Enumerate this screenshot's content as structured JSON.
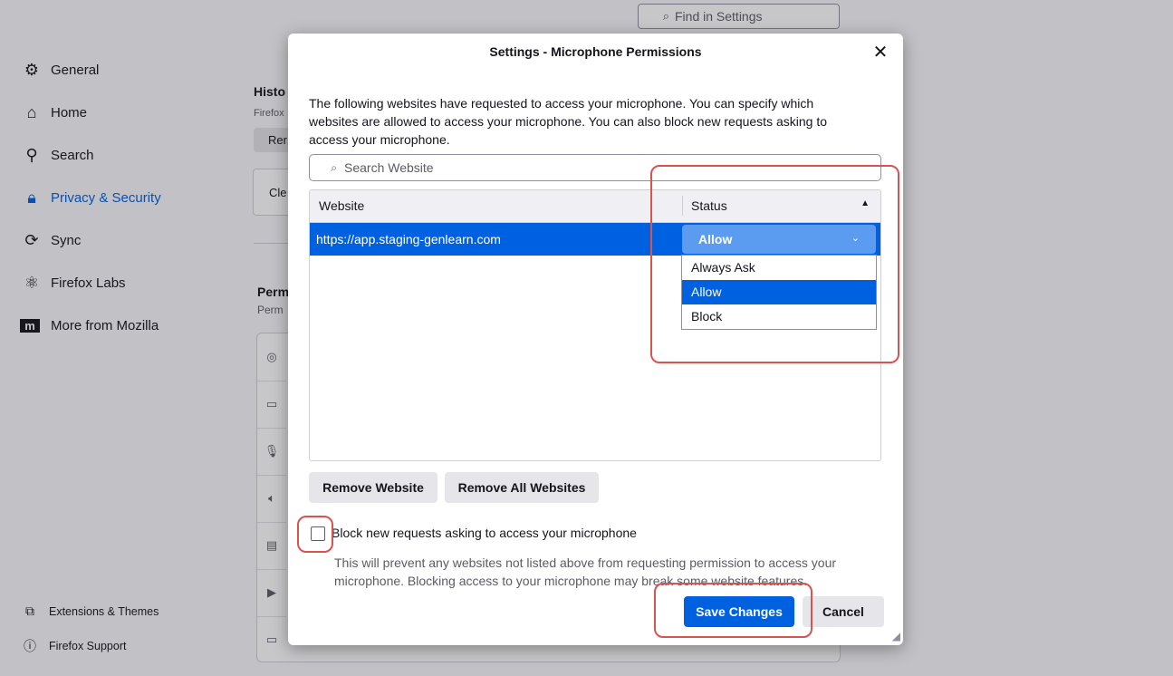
{
  "background": {
    "find_placeholder": "Find in Settings",
    "sidebar": [
      {
        "label": "General",
        "icon": "gear-icon"
      },
      {
        "label": "Home",
        "icon": "home-icon"
      },
      {
        "label": "Search",
        "icon": "search-icon"
      },
      {
        "label": "Privacy & Security",
        "icon": "lock-icon",
        "active": true
      },
      {
        "label": "Sync",
        "icon": "sync-icon"
      },
      {
        "label": "Firefox Labs",
        "icon": "labs-icon"
      },
      {
        "label": "More from Mozilla",
        "icon": "mozilla-icon"
      }
    ],
    "footer": [
      {
        "label": "Extensions & Themes",
        "icon": "puzzle-icon"
      },
      {
        "label": "Firefox Support",
        "icon": "help-icon"
      }
    ],
    "history_heading": "Histo",
    "history_sub": "Firefox",
    "history_btn": "Rer",
    "clear_btn": "Cle",
    "perm_heading": "Perm",
    "perm_sub": "Perm"
  },
  "dialog": {
    "title": "Settings - Microphone Permissions",
    "close_glyph": "✕",
    "description": "The following websites have requested to access your microphone. You can specify which websites are allowed to access your microphone. You can also block new requests asking to access your microphone.",
    "search_placeholder": "Search Website",
    "columns": {
      "website": "Website",
      "status": "Status"
    },
    "rows": [
      {
        "website": "https://app.staging-genlearn.com",
        "status": "Allow"
      }
    ],
    "status_options": [
      "Always Ask",
      "Allow",
      "Block"
    ],
    "selected_option": "Allow",
    "remove_website": "Remove Website",
    "remove_all": "Remove All Websites",
    "block_label": "Block new requests asking to access your microphone",
    "block_desc": "This will prevent any websites not listed above from requesting permission to access your microphone. Blocking access to your microphone may break some website features.",
    "block_checked": false,
    "save": "Save Changes",
    "cancel": "Cancel"
  },
  "colors": {
    "accent": "#0061e0",
    "highlight": "#d9534f"
  }
}
